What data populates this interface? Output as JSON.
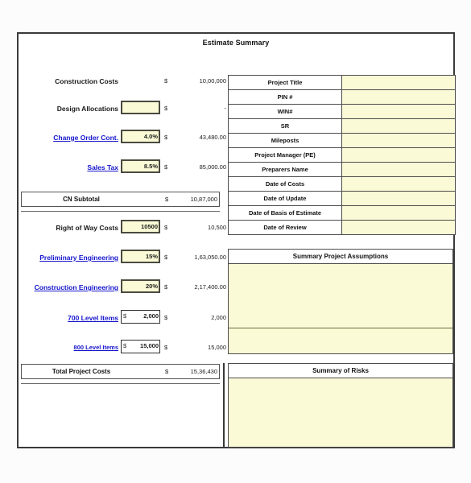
{
  "title": "Estimate Summary",
  "colors": {
    "input_fill": "#fafad7",
    "link": "#1414cc",
    "border": "#3a3a3a"
  },
  "left": {
    "rows": [
      {
        "label": "Construction Costs",
        "is_link": false,
        "has_input": false,
        "input_value": "",
        "dollar": "$",
        "amount": "10,00,000"
      },
      {
        "label": "Design Allocations",
        "is_link": false,
        "has_input": true,
        "input_value": "",
        "dollar": "$",
        "amount": "-"
      },
      {
        "label": "Change Order Cont.",
        "is_link": true,
        "has_input": true,
        "input_value": "4.0%",
        "dollar": "$",
        "amount": "43,480.00"
      },
      {
        "label": "Sales Tax",
        "is_link": true,
        "has_input": true,
        "input_value": "8.5%",
        "dollar": "$",
        "amount": "85,000.00"
      }
    ],
    "subtotal": {
      "label": "CN Subtotal",
      "dollar": "$",
      "amount": "10,87,000"
    },
    "rows2": [
      {
        "label": "Right of Way Costs",
        "is_link": false,
        "has_input": true,
        "input_value": "10500",
        "input_prefix": "",
        "white_input": false,
        "dollar": "$",
        "amount": "10,500"
      },
      {
        "label": "Preliminary Engineering",
        "is_link": true,
        "has_input": true,
        "input_value": "15%",
        "input_prefix": "",
        "white_input": false,
        "dollar": "$",
        "amount": "1,63,050.00"
      },
      {
        "label": "Construction Engineering",
        "is_link": true,
        "has_input": true,
        "input_value": "20%",
        "input_prefix": "",
        "white_input": false,
        "dollar": "$",
        "amount": "2,17,400.00"
      },
      {
        "label": "700 Level Items",
        "is_link": true,
        "has_input": true,
        "input_value": "2,000",
        "input_prefix": "$",
        "white_input": true,
        "dollar": "$",
        "amount": "2,000"
      },
      {
        "label": "800 Level Items",
        "is_link": true,
        "has_input": true,
        "input_value": "15,000",
        "input_prefix": "$",
        "white_input": true,
        "dollar": "$",
        "amount": "15,000"
      }
    ],
    "total": {
      "label": "Total Project Costs",
      "dollar": "$",
      "amount": "15,36,430"
    }
  },
  "right": {
    "info_rows": [
      {
        "key": "Project Title",
        "value": ""
      },
      {
        "key": "PIN #",
        "value": ""
      },
      {
        "key": "WIN#",
        "value": ""
      },
      {
        "key": "SR",
        "value": ""
      },
      {
        "key": "Mileposts",
        "value": ""
      },
      {
        "key": "Project Manager (PE)",
        "value": ""
      },
      {
        "key": "Preparers Name",
        "value": ""
      },
      {
        "key": "Date of Costs",
        "value": ""
      },
      {
        "key": "Date of Update",
        "value": ""
      },
      {
        "key": "Date of Basis of Estimate",
        "value": ""
      },
      {
        "key": "Date of Review",
        "value": ""
      }
    ],
    "assumptions": {
      "title": "Summary Project Assumptions",
      "body": ""
    },
    "risks": {
      "title": "Summary of Risks",
      "body": ""
    }
  }
}
